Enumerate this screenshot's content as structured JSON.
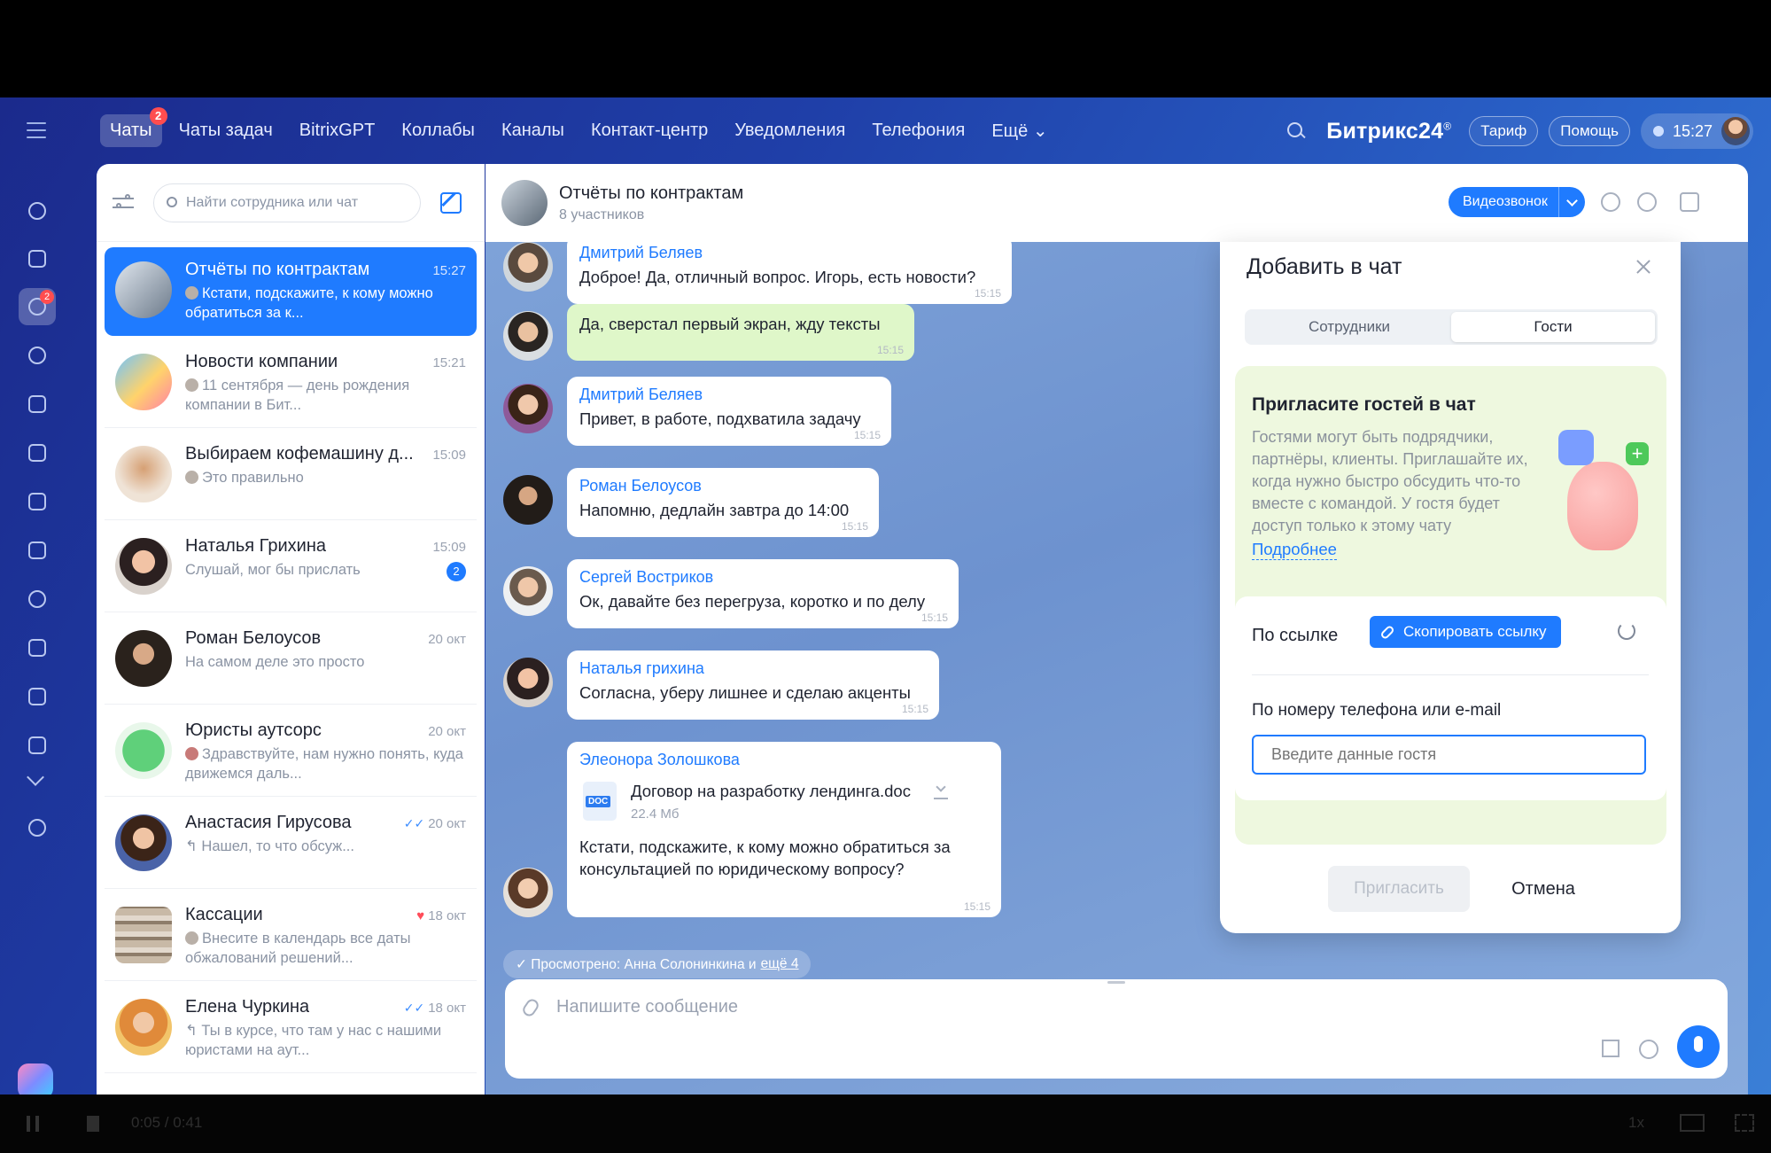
{
  "nav": {
    "tabs": [
      {
        "label": "Чаты",
        "badge": "2",
        "active": true
      },
      {
        "label": "Чаты задач"
      },
      {
        "label": "BitrixGPT"
      },
      {
        "label": "Коллабы"
      },
      {
        "label": "Каналы"
      },
      {
        "label": "Контакт-центр"
      },
      {
        "label": "Уведомления"
      },
      {
        "label": "Телефония"
      },
      {
        "label": "Ещё ⌄"
      }
    ],
    "brand": "Битрикс24",
    "brand_mark": "®",
    "tariff": "Тариф",
    "help": "Помощь",
    "clock": "15:27"
  },
  "rail": {
    "icons": [
      "feed-icon",
      "tasks-icon",
      "chats-icon",
      "groups-icon",
      "calendar-icon",
      "documents-icon",
      "drive-icon",
      "mail-icon",
      "contacts-icon",
      "checklist-icon",
      "filter-icon",
      "sign-icon"
    ],
    "chats_badge": "2"
  },
  "chat_list": {
    "search_placeholder": "Найти сотрудника или чат",
    "items": [
      {
        "name": "Отчёты по контрактам",
        "time": "15:27",
        "preview": "Кстати, подскажите, к кому можно обратиться за к...",
        "active": true
      },
      {
        "name": "Новости компании",
        "time": "15:21",
        "preview": "11 сентября — день рождения компании в Бит..."
      },
      {
        "name": "Выбираем кофемашину д...",
        "time": "15:09",
        "preview": "Это правильно"
      },
      {
        "name": "Наталья Грихина",
        "time": "15:09",
        "preview": "Слушай, мог бы прислать",
        "unread": "2"
      },
      {
        "name": "Роман Белоусов",
        "time": "20 окт",
        "preview": "На самом деле это просто"
      },
      {
        "name": "Юристы аутсорс",
        "time": "20 окт",
        "preview": "Здравствуйте, нам нужно понять, куда движемся даль..."
      },
      {
        "name": "Анастасия Гирусова",
        "time": "20 окт",
        "preview": "↰ Нашел, то что обсуж..."
      },
      {
        "name": "Кассации",
        "time": "18 окт",
        "preview": "Внесите в календарь все даты обжалований решений..."
      },
      {
        "name": "Елена Чуркина",
        "time": "18 окт",
        "preview": "↰ Ты в курсе, что там у нас с нашими юристами на аут..."
      }
    ]
  },
  "chat_header": {
    "title": "Отчёты по контрактам",
    "subtitle": "8 участников",
    "video_label": "Видеозвонок"
  },
  "messages": [
    {
      "author": "Дмитрий Беляев",
      "text": "Доброе! Да, отличный вопрос. Игорь, есть новости?",
      "time": "15:15"
    },
    {
      "author": "",
      "text": "Да, сверстал первый экран, жду тексты",
      "time": "15:15",
      "mine": true
    },
    {
      "author": "Дмитрий Беляев",
      "text": "Привет, в работе, подхватила задачу",
      "time": "15:15"
    },
    {
      "author": "Роман Белоусов",
      "text": "Напомню, дедлайн завтра до 14:00",
      "time": "15:15"
    },
    {
      "author": "Сергей Востриков",
      "text": "Ок, давайте без перегруза, коротко и по делу",
      "time": "15:15"
    },
    {
      "author": "Наталья грихина",
      "text": "Согласна, уберу лишнее и сделаю акценты",
      "time": "15:15"
    },
    {
      "author": "Элеонора Золошкова",
      "file_name": "Договор на разработку лендинга.doc",
      "file_size": "22.4 Мб",
      "file_type": "DOC",
      "text": "Кстати, подскажите, к кому можно обратиться за консультацией по юридическому вопросу?",
      "time": "15:15"
    }
  ],
  "seen": {
    "text": "✓ Просмотрено: Анна Солонинкина и",
    "more": "ещё 4"
  },
  "composer": {
    "placeholder": "Напишите сообщение"
  },
  "dialog": {
    "title": "Добавить в чат",
    "tabs": [
      "Сотрудники",
      "Гости"
    ],
    "active_tab": "Гости",
    "invite_title": "Пригласите гостей в чат",
    "invite_text": "Гостями могут быть подрядчики, партнёры, клиенты. Приглашайте их, когда нужно быстро обсудить что-то вместе с командой. У гостя будет доступ только к этому чату",
    "more_link": "Подробнее",
    "by_link_label": "По ссылке",
    "copy_link_label": "Скопировать ссылку",
    "by_contact_label": "По номеру телефона или e-mail",
    "guest_input_placeholder": "Введите данные гостя",
    "invite_button": "Пригласить",
    "cancel_button": "Отмена"
  },
  "player": {
    "time": "0:05 / 0:41",
    "speed": "1x"
  }
}
